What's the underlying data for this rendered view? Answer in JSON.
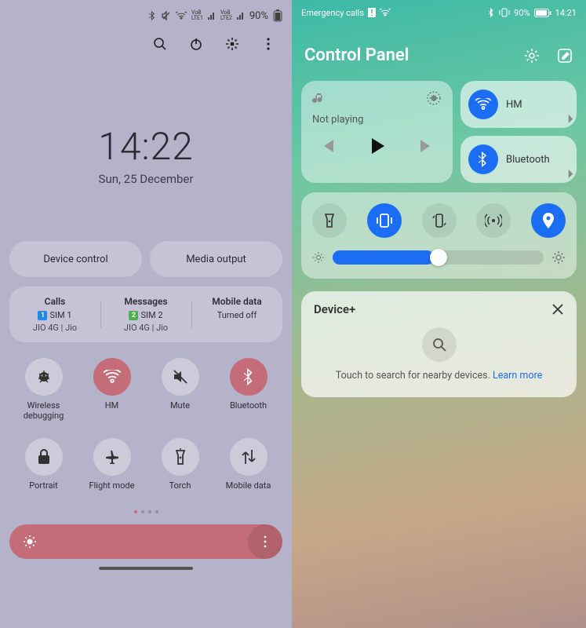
{
  "left": {
    "status": {
      "battery": "90%"
    },
    "clock": "14:22",
    "date": "Sun, 25 December",
    "pills": {
      "device_control": "Device control",
      "media_output": "Media output"
    },
    "sim": {
      "calls": {
        "header": "Calls",
        "chip": "1",
        "label": "SIM 1",
        "sub": "JIO 4G | Jio"
      },
      "msgs": {
        "header": "Messages",
        "chip": "2",
        "label": "SIM 2",
        "sub": "JIO 4G | Jio"
      },
      "data": {
        "header": "Mobile data",
        "value": "Turned off"
      }
    },
    "toggles": [
      {
        "name": "wireless-debug",
        "label": "Wireless debugging",
        "on": false,
        "icon": "bug"
      },
      {
        "name": "wifi",
        "label": "HM",
        "on": true,
        "icon": "wifi"
      },
      {
        "name": "mute",
        "label": "Mute",
        "on": false,
        "icon": "mute"
      },
      {
        "name": "bluetooth",
        "label": "Bluetooth",
        "on": true,
        "icon": "bluetooth"
      },
      {
        "name": "portrait",
        "label": "Portrait",
        "on": false,
        "icon": "lock"
      },
      {
        "name": "flight",
        "label": "Flight mode",
        "on": false,
        "icon": "plane"
      },
      {
        "name": "torch",
        "label": "Torch",
        "on": false,
        "icon": "torch"
      },
      {
        "name": "mobiledata",
        "label": "Mobile data",
        "on": false,
        "icon": "updown"
      }
    ]
  },
  "right": {
    "status": {
      "left": "Emergency calls",
      "battery": "90%",
      "time": "14:21"
    },
    "title": "Control Panel",
    "media": {
      "status": "Not playing"
    },
    "wifi": {
      "label": "HM"
    },
    "bt": {
      "label": "Bluetooth"
    },
    "device": {
      "title": "Device+",
      "hint_pre": "Touch to search for nearby devices. ",
      "hint_link": "Learn more"
    }
  }
}
